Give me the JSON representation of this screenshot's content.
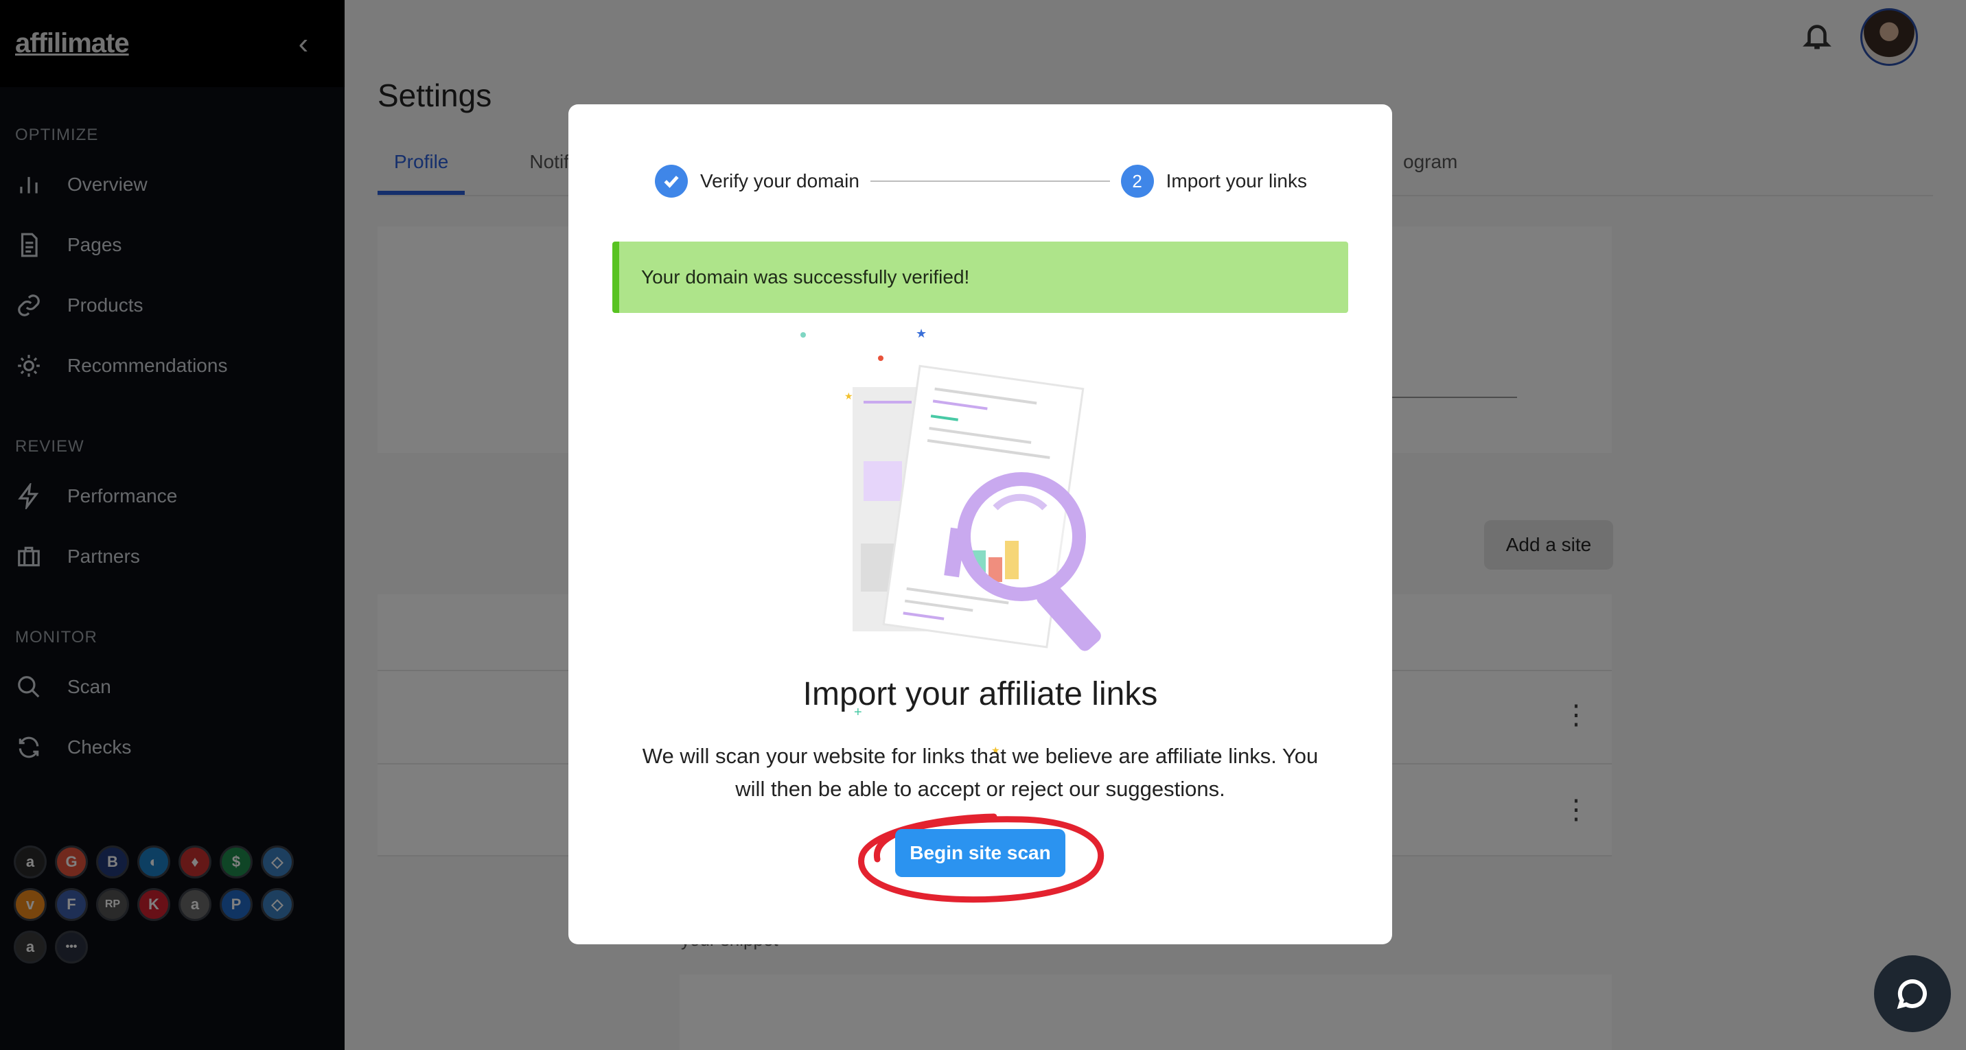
{
  "brand": {
    "logo_text": "affilimate"
  },
  "sidebar": {
    "collapse_icon": "chevron-left-icon",
    "sections": [
      {
        "title": "OPTIMIZE",
        "items": [
          {
            "label": "Overview",
            "icon": "bar-chart-icon"
          },
          {
            "label": "Pages",
            "icon": "document-icon"
          },
          {
            "label": "Products",
            "icon": "link-icon"
          },
          {
            "label": "Recommendations",
            "icon": "sun-icon"
          }
        ]
      },
      {
        "title": "REVIEW",
        "items": [
          {
            "label": "Performance",
            "icon": "lightning-icon"
          },
          {
            "label": "Partners",
            "icon": "briefcase-icon"
          }
        ]
      },
      {
        "title": "MONITOR",
        "items": [
          {
            "label": "Scan",
            "icon": "search-icon"
          },
          {
            "label": "Checks",
            "icon": "refresh-icon"
          }
        ]
      }
    ],
    "partners": [
      {
        "glyph": "a",
        "color": "#2b2b2b",
        "name": "amazon-partner-icon"
      },
      {
        "glyph": "G",
        "color": "#e2533a",
        "name": "g-partner-icon"
      },
      {
        "glyph": "B",
        "color": "#233a7a",
        "name": "b-partner-icon"
      },
      {
        "glyph": "◐",
        "color": "#1a7ec4",
        "name": "circle-partner-icon"
      },
      {
        "glyph": "♦",
        "color": "#c8302f",
        "name": "diamond-partner-icon"
      },
      {
        "glyph": "$",
        "color": "#1f8a4c",
        "name": "dollar-partner-icon"
      },
      {
        "glyph": "◇",
        "color": "#3b7fbf",
        "name": "gem-partner-icon"
      },
      {
        "glyph": "v",
        "color": "#f08a1a",
        "name": "v-partner-icon"
      },
      {
        "glyph": "F",
        "color": "#3d5eaa",
        "name": "f-partner-icon"
      },
      {
        "glyph": "RP",
        "color": "#555555",
        "name": "rp-partner-icon"
      },
      {
        "glyph": "K",
        "color": "#d0202f",
        "name": "k-partner-icon"
      },
      {
        "glyph": "a",
        "color": "#6a6a6a",
        "name": "amazon-assoc-partner-icon"
      },
      {
        "glyph": "P",
        "color": "#2169c4",
        "name": "p-partner-icon"
      },
      {
        "glyph": "◇",
        "color": "#3b7fbf",
        "name": "gem2-partner-icon"
      },
      {
        "glyph": "a",
        "color": "#3a3a3a",
        "name": "amazon2-partner-icon"
      },
      {
        "glyph": "•••",
        "color": "#2b3140",
        "name": "more-partners-icon"
      }
    ]
  },
  "header": {
    "bell_icon": "bell-icon",
    "avatar": "user-avatar"
  },
  "page": {
    "title": "Settings",
    "tabs": [
      {
        "label": "Profile",
        "active": true
      },
      {
        "label": "Notif"
      }
    ],
    "ghost_tab": "ogram",
    "add_site_label": "Add a site",
    "snippet_label": "your snippet"
  },
  "modal": {
    "steps": [
      {
        "label": "Verify your domain",
        "state": "done"
      },
      {
        "label": "Import your links",
        "state": "current",
        "number": "2"
      }
    ],
    "alert": "Your domain was successfully verified!",
    "title": "Import your affiliate links",
    "description": "We will scan your website for links that we believe are affiliate links. You will then be able to accept or reject our suggestions.",
    "cta": "Begin site scan",
    "annotation_color": "#e3222f"
  },
  "colors": {
    "accent": "#2b93f0",
    "step": "#3f86e8",
    "success_bg": "#aee48a",
    "success_border": "#58c322",
    "sidebar_bg": "#0a0d12"
  },
  "chat_icon": "chat-bubble-icon"
}
